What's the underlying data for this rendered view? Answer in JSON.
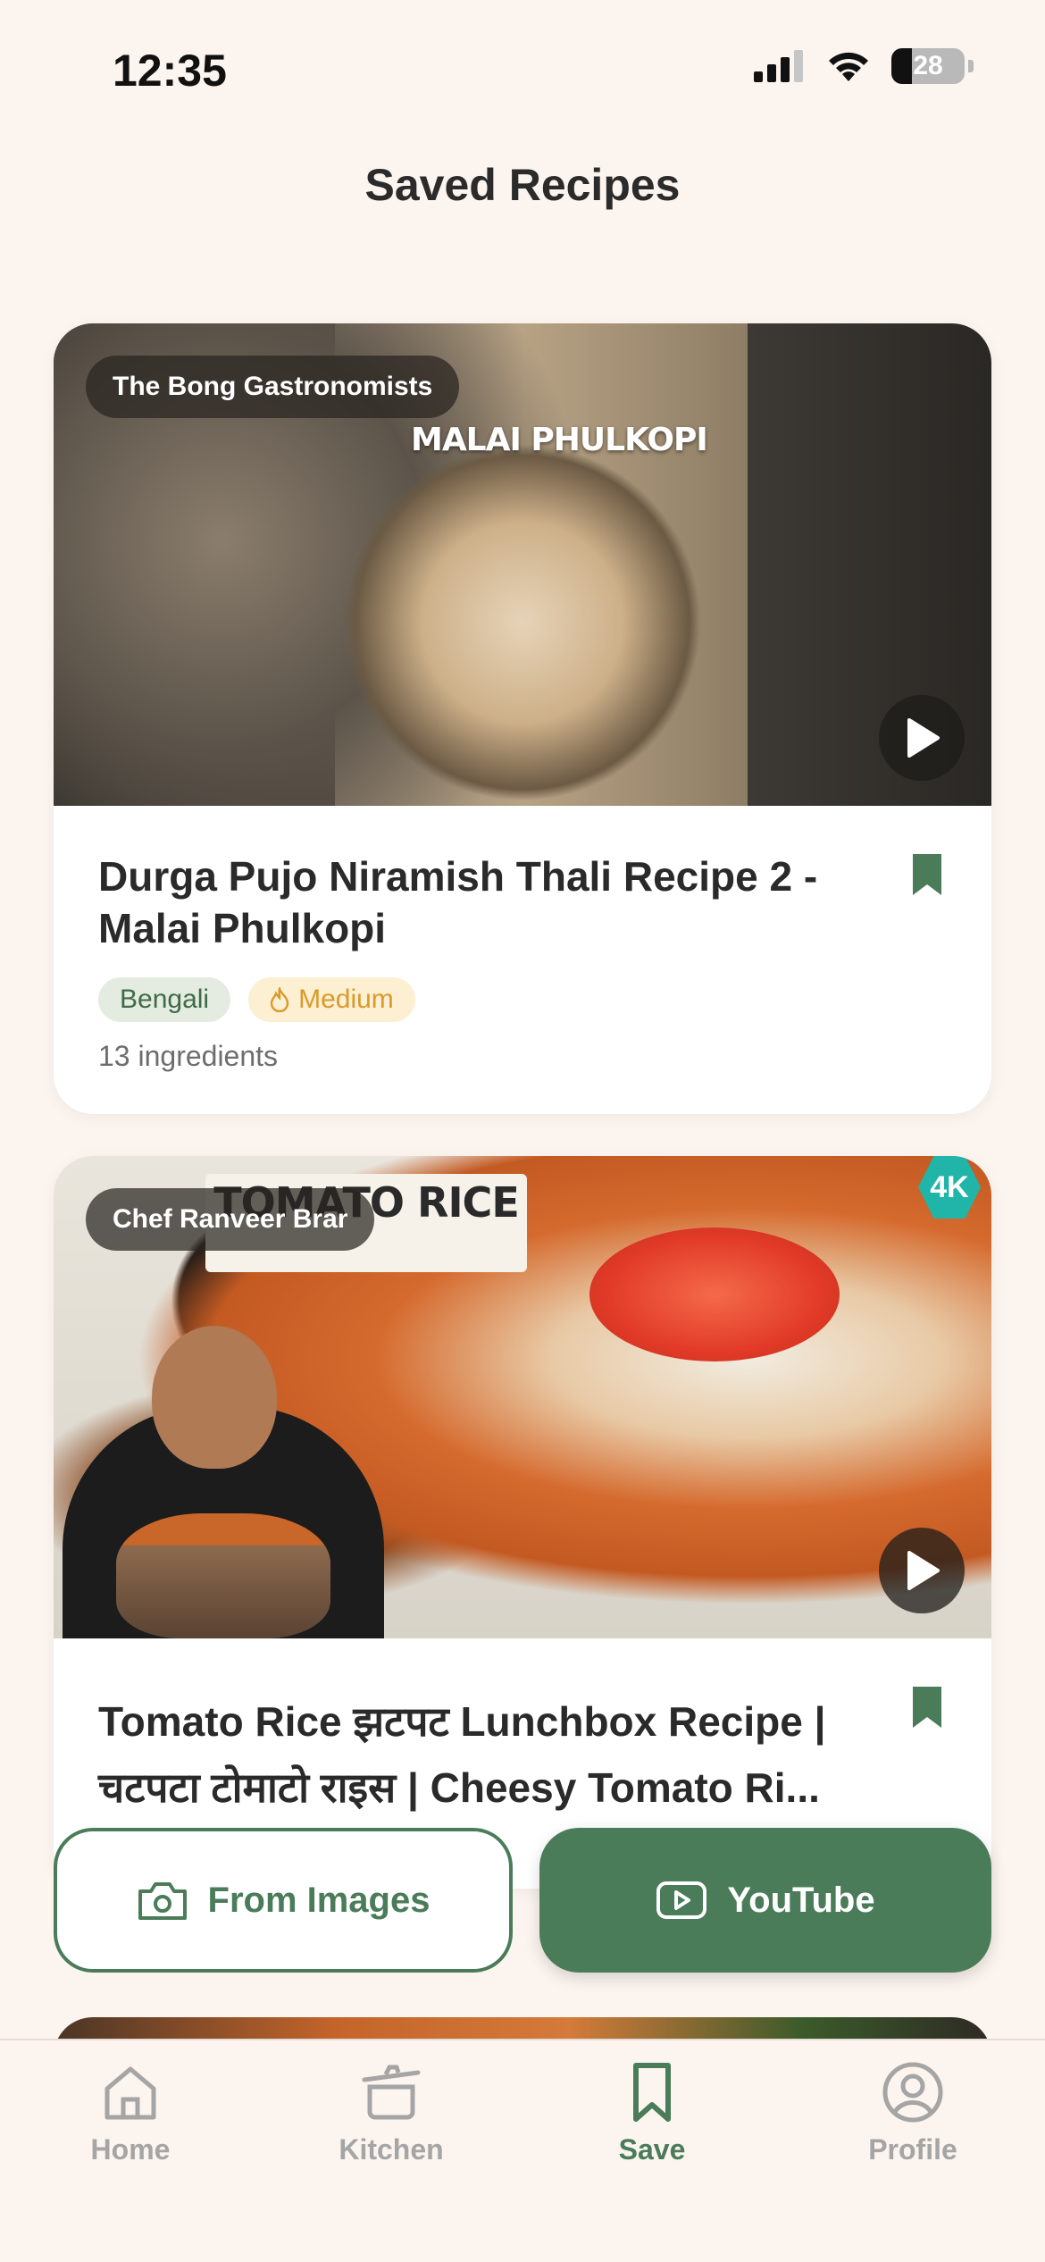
{
  "status_bar": {
    "time": "12:35",
    "battery": "28"
  },
  "header": {
    "title": "Saved Recipes"
  },
  "recipes": [
    {
      "source": "The Bong Gastronomists",
      "thumbnail_text": "MALAI PHULKOPI",
      "title": "Durga Pujo Niramish Thali Recipe 2 - Malai Phulkopi",
      "cuisine": "Bengali",
      "difficulty": "Medium",
      "ingredients": "13 ingredients"
    },
    {
      "source": "Chef Ranveer Brar",
      "thumbnail_text": "TOMATO RICE",
      "thumbnail_badge": "4K",
      "title": "Tomato Rice झटपट Lunchbox Recipe | चटपटा टोमाटो राइस | Cheesy Tomato Ri..."
    }
  ],
  "actions": {
    "from_images": "From Images",
    "youtube": "YouTube"
  },
  "tabs": [
    {
      "label": "Home",
      "icon": "home-icon",
      "active": false
    },
    {
      "label": "Kitchen",
      "icon": "pot-icon",
      "active": false
    },
    {
      "label": "Save",
      "icon": "bookmark-icon",
      "active": true
    },
    {
      "label": "Profile",
      "icon": "profile-icon",
      "active": false
    }
  ],
  "colors": {
    "accent": "#4a7c59",
    "background": "#fcf4ee",
    "tag_cuisine_bg": "#e4ece1",
    "tag_difficulty_bg": "#fcefd2",
    "tag_difficulty_text": "#d99a2a",
    "inactive_tab": "#a5a5a5"
  }
}
